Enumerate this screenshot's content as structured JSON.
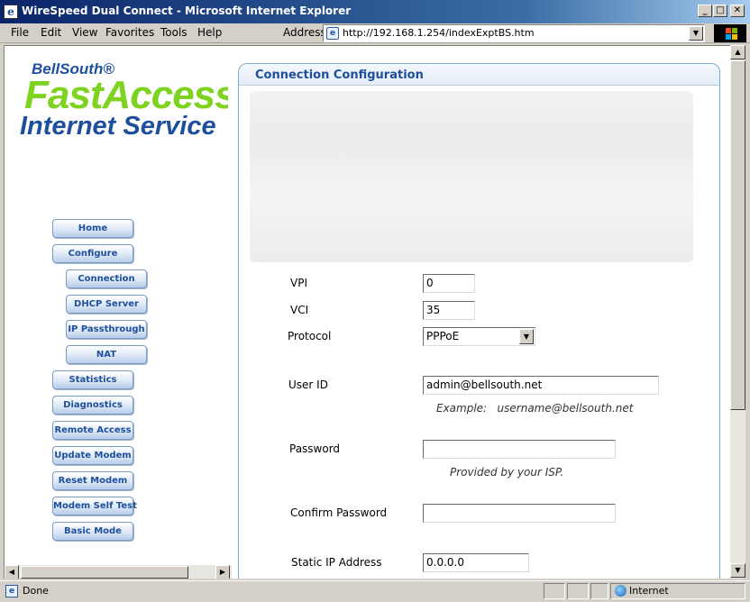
{
  "window": {
    "title": "WireSpeed Dual Connect - Microsoft Internet Explorer",
    "min_label": "_",
    "max_label": "□",
    "close_label": "✕"
  },
  "menu": [
    "File",
    "Edit",
    "View",
    "Favorites",
    "Tools",
    "Help"
  ],
  "address": {
    "label": "Address",
    "url": "http://192.168.1.254/indexExptBS.htm"
  },
  "logo": {
    "brand": "BellSouth®",
    "product": "FastAccess",
    "service": "Internet Service"
  },
  "nav": {
    "home": "Home",
    "configure": "Configure",
    "connection": "Connection",
    "dhcp_server": "DHCP Server",
    "ip_passthrough": "IP Passthrough",
    "nat": "NAT",
    "statistics": "Statistics",
    "diagnostics": "Diagnostics",
    "remote_access": "Remote Access",
    "update_modem": "Update Modem",
    "reset_modem": "Reset Modem",
    "modem_self_test": "Modem Self Test",
    "basic_mode": "Basic Mode"
  },
  "config": {
    "title": "Connection Configuration",
    "vpi": {
      "label": "VPI",
      "value": "0"
    },
    "vci": {
      "label": "VCI",
      "value": "35"
    },
    "protocol": {
      "label": "Protocol",
      "value": "PPPoE"
    },
    "user_id": {
      "label": "User ID",
      "value": "admin@bellsouth.net",
      "hint": "Example:   username@bellsouth.net"
    },
    "password": {
      "label": "Password",
      "value": "",
      "hint": "Provided by your ISP."
    },
    "confirm_password": {
      "label": "Confirm Password",
      "value": ""
    },
    "static_ip": {
      "label": "Static IP Address",
      "value": "0.0.0.0"
    }
  },
  "status": {
    "text": "Done",
    "zone": "Internet"
  },
  "colors": {
    "brand_blue": "#1e4f9c",
    "brand_green": "#7ed321",
    "titlebar": "#0a246a"
  }
}
